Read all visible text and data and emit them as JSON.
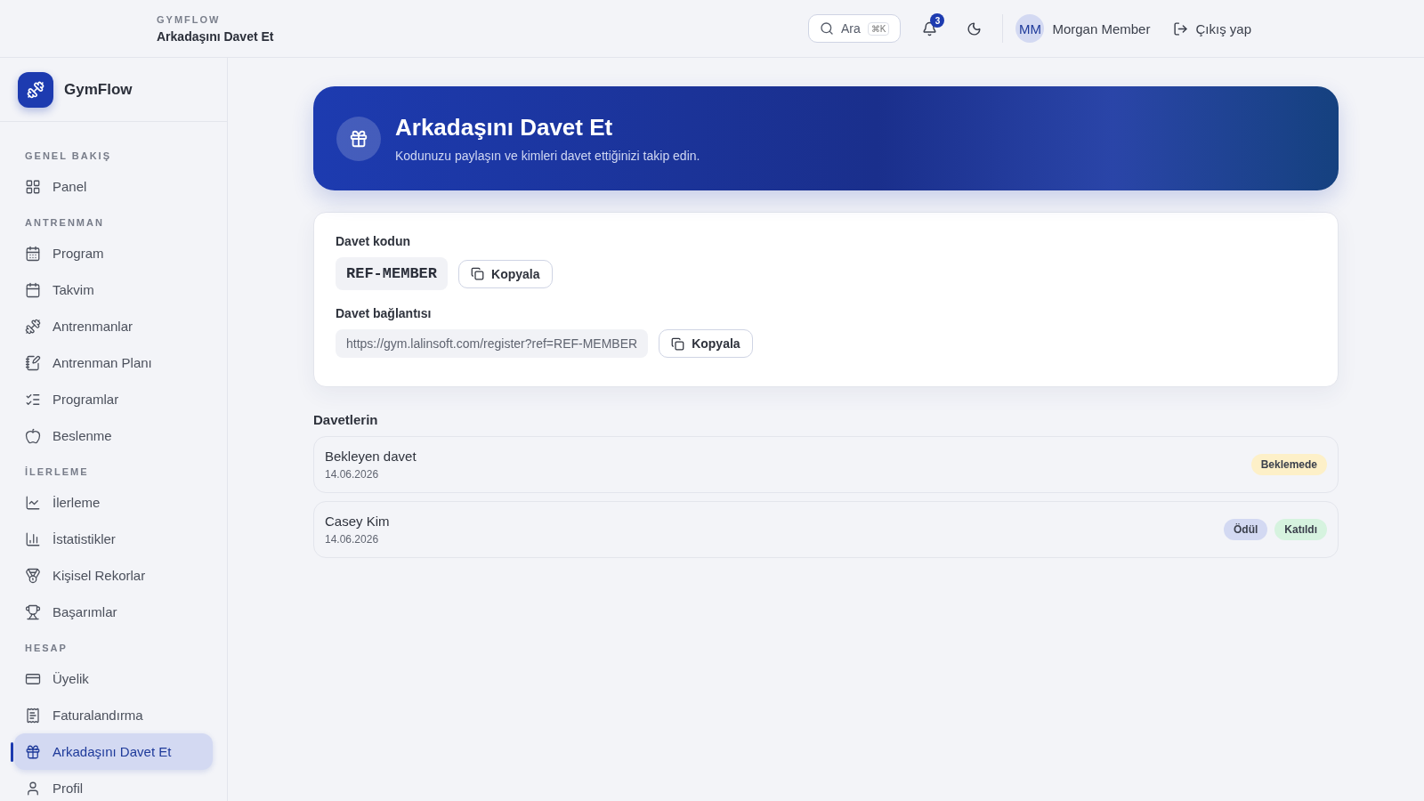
{
  "header": {
    "brand": "GYMFLOW",
    "page_title": "Arkadaşını Davet Et",
    "search": {
      "label": "Ara",
      "shortcut": "⌘K"
    },
    "notifications": {
      "count": "3"
    },
    "user": {
      "initials": "MM",
      "name": "Morgan Member"
    },
    "logout": "Çıkış yap"
  },
  "sidebar": {
    "app_name": "GymFlow",
    "sections": [
      {
        "title": "GENEL BAKIŞ",
        "items": [
          {
            "label": "Panel",
            "selected": false
          }
        ]
      },
      {
        "title": "ANTRENMAN",
        "items": [
          {
            "label": "Program",
            "selected": false
          },
          {
            "label": "Takvim",
            "selected": false
          },
          {
            "label": "Antrenmanlar",
            "selected": false
          },
          {
            "label": "Antrenman Planı",
            "selected": false
          },
          {
            "label": "Programlar",
            "selected": false
          },
          {
            "label": "Beslenme",
            "selected": false
          }
        ]
      },
      {
        "title": "İLERLEME",
        "items": [
          {
            "label": "İlerleme",
            "selected": false
          },
          {
            "label": "İstatistikler",
            "selected": false
          },
          {
            "label": "Kişisel Rekorlar",
            "selected": false
          },
          {
            "label": "Başarımlar",
            "selected": false
          }
        ]
      },
      {
        "title": "HESAP",
        "items": [
          {
            "label": "Üyelik",
            "selected": false
          },
          {
            "label": "Faturalandırma",
            "selected": false
          },
          {
            "label": "Arkadaşını Davet Et",
            "selected": true
          },
          {
            "label": "Profil",
            "selected": false
          }
        ]
      }
    ]
  },
  "hero": {
    "title": "Arkadaşını Davet Et",
    "subtitle": "Kodunuzu paylaşın ve kimleri davet ettiğinizi takip edin."
  },
  "invite_card": {
    "code_label": "Davet kodun",
    "code": "REF-MEMBER",
    "code_copy": "Kopyala",
    "link_label": "Davet bağlantısı",
    "link": "https://gym.lalinsoft.com/register?ref=REF-MEMBER",
    "link_copy": "Kopyala"
  },
  "invites": {
    "title": "Davetlerin",
    "rows": [
      {
        "name": "Bekleyen davet",
        "date": "14.06.2026",
        "tags": [
          {
            "label": "Beklemede",
            "color": "#fdf0c8"
          }
        ]
      },
      {
        "name": "Casey Kim",
        "date": "14.06.2026",
        "tags": [
          {
            "label": "Ödül",
            "color": "#d3d9f2"
          },
          {
            "label": "Katıldı",
            "color": "#d6f3df"
          }
        ]
      }
    ]
  }
}
